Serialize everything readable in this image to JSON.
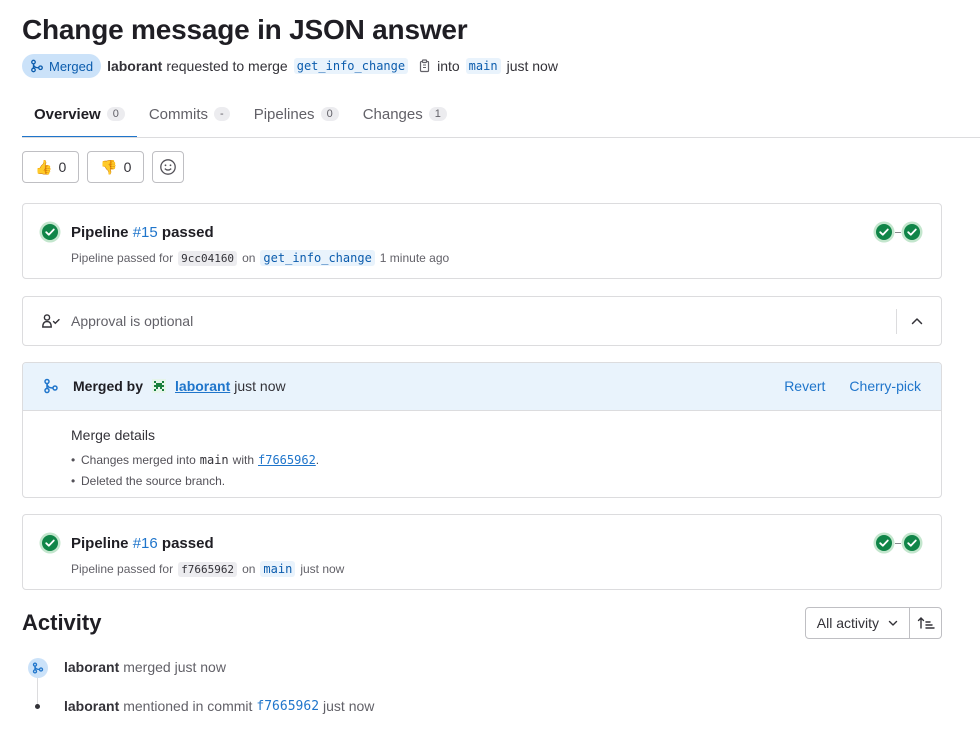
{
  "title": "Change message in JSON answer",
  "meta": {
    "status_badge": "Merged",
    "author": "laborant",
    "requested_text": "requested to merge",
    "source_branch": "get_info_change",
    "into_text": "into",
    "target_branch": "main",
    "time": "just now"
  },
  "tabs": [
    {
      "label": "Overview",
      "count": "0"
    },
    {
      "label": "Commits",
      "count": "-"
    },
    {
      "label": "Pipelines",
      "count": "0"
    },
    {
      "label": "Changes",
      "count": "1"
    }
  ],
  "reactions": {
    "thumbs_up": {
      "emoji": "👍",
      "count": "0"
    },
    "thumbs_down": {
      "emoji": "👎",
      "count": "0"
    }
  },
  "pipeline1": {
    "label": "Pipeline",
    "id": "#15",
    "status": "passed",
    "passed_for": "Pipeline passed for",
    "sha": "9cc04160",
    "on": "on",
    "branch": "get_info_change",
    "time": "1 minute ago"
  },
  "approval": {
    "text": "Approval is optional"
  },
  "merged": {
    "by_text": "Merged by",
    "user": "laborant",
    "time": "just now",
    "revert": "Revert",
    "cherry_pick": "Cherry-pick",
    "details_title": "Merge details",
    "detail1_prefix": "Changes merged into",
    "detail1_branch": "main",
    "detail1_with": "with",
    "detail1_sha": "f7665962",
    "detail1_suffix": ".",
    "detail2": "Deleted the source branch."
  },
  "pipeline2": {
    "label": "Pipeline",
    "id": "#16",
    "status": "passed",
    "passed_for": "Pipeline passed for",
    "sha": "f7665962",
    "on": "on",
    "branch": "main",
    "time": "just now"
  },
  "activity": {
    "title": "Activity",
    "filter": "All activity",
    "item1_user": "laborant",
    "item1_text": "merged just now",
    "item2_user": "laborant",
    "item2_text": "mentioned in commit",
    "item2_sha": "f7665962",
    "item2_time": "just now"
  },
  "colors": {
    "accent": "#1f75cb",
    "success": "#108548",
    "merged_bg": "#cbe2f9"
  }
}
